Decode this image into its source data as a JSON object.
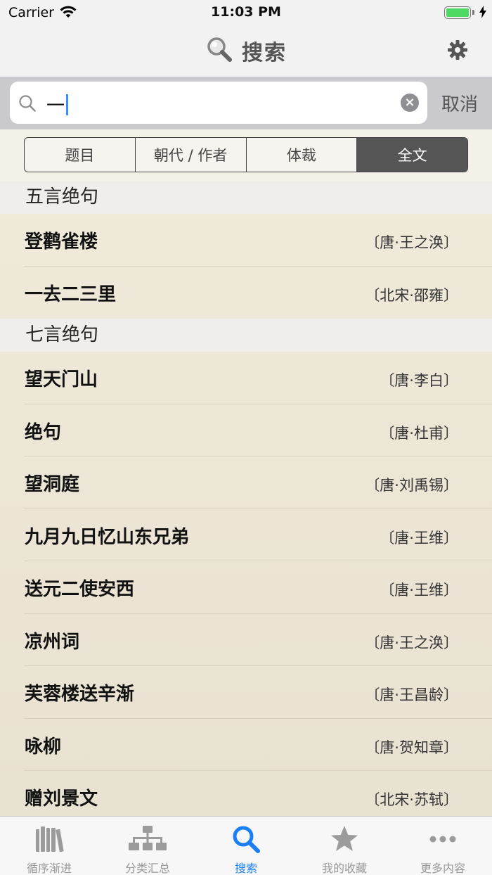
{
  "status_bar": {
    "carrier": "Carrier",
    "time": "11:03 PM"
  },
  "nav": {
    "title": "搜索"
  },
  "search": {
    "value": "一",
    "cancel_label": "取消"
  },
  "segments": [
    {
      "label": "题目",
      "active": false
    },
    {
      "label": "朝代 / 作者",
      "active": false
    },
    {
      "label": "体裁",
      "active": false
    },
    {
      "label": "全文",
      "active": true
    }
  ],
  "sections": [
    {
      "header": "五言绝句",
      "rows": [
        {
          "title": "登鹳雀楼",
          "author": "〔唐·王之涣〕"
        },
        {
          "title": "一去二三里",
          "author": "〔北宋·邵雍〕"
        }
      ]
    },
    {
      "header": "七言绝句",
      "rows": [
        {
          "title": "望天门山",
          "author": "〔唐·李白〕"
        },
        {
          "title": "绝句",
          "author": "〔唐·杜甫〕"
        },
        {
          "title": "望洞庭",
          "author": "〔唐·刘禹锡〕"
        },
        {
          "title": "九月九日忆山东兄弟",
          "author": "〔唐·王维〕"
        },
        {
          "title": "送元二使安西",
          "author": "〔唐·王维〕"
        },
        {
          "title": "凉州词",
          "author": "〔唐·王之涣〕"
        },
        {
          "title": "芙蓉楼送辛渐",
          "author": "〔唐·王昌龄〕"
        },
        {
          "title": "咏柳",
          "author": "〔唐·贺知章〕"
        },
        {
          "title": "赠刘景文",
          "author": "〔北宋·苏轼〕"
        }
      ]
    }
  ],
  "tabs": [
    {
      "label": "循序渐进",
      "icon": "books-icon",
      "active": false
    },
    {
      "label": "分类汇总",
      "icon": "hierarchy-icon",
      "active": false
    },
    {
      "label": "搜索",
      "icon": "search-icon",
      "active": true
    },
    {
      "label": "我的收藏",
      "icon": "star-icon",
      "active": false
    },
    {
      "label": "更多内容",
      "icon": "more-icon",
      "active": false
    }
  ],
  "colors": {
    "accent": "#1a7ef5",
    "inactive": "#999999",
    "battery": "#4cd964"
  }
}
